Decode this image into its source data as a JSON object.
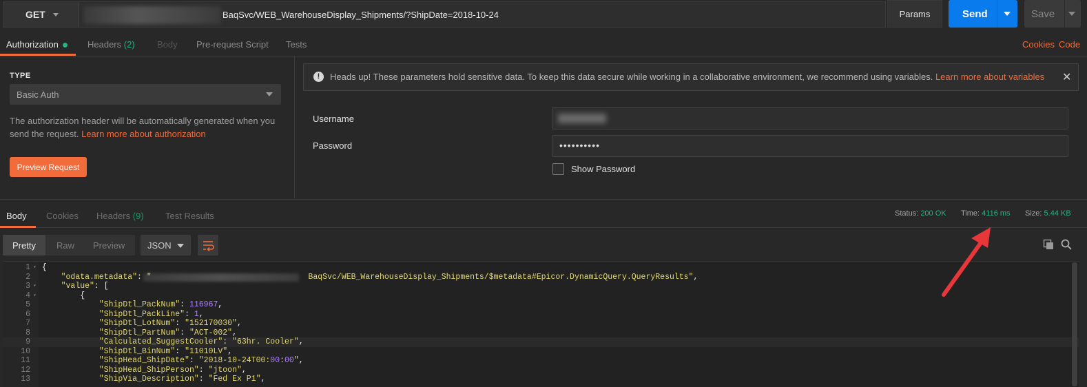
{
  "request": {
    "method": "GET",
    "url_visible": "BaqSvc/WEB_WarehouseDisplay_Shipments/?ShipDate=2018-10-24",
    "params_label": "Params",
    "send_label": "Send",
    "save_label": "Save"
  },
  "request_tabs": {
    "authorization": "Authorization",
    "headers": "Headers",
    "headers_count": "(2)",
    "body": "Body",
    "prerequest": "Pre-request Script",
    "tests": "Tests",
    "cookies": "Cookies",
    "code": "Code"
  },
  "auth": {
    "type_header": "TYPE",
    "type_value": "Basic Auth",
    "desc_line1": "The authorization header will be automatically generated when you",
    "desc_line2": "send the request.",
    "learn_link": "Learn more about authorization",
    "preview_button": "Preview Request",
    "warning_text": "Heads up! These parameters hold sensitive data. To keep this data secure while working in a collaborative environment, we recommend using variables.",
    "warning_link": "Learn more about variables",
    "username_label": "Username",
    "password_label": "Password",
    "password_value": "••••••••••",
    "show_password_label": "Show Password"
  },
  "response_tabs": {
    "body": "Body",
    "cookies": "Cookies",
    "headers": "Headers",
    "headers_count": "(9)",
    "test_results": "Test Results"
  },
  "status": {
    "status_label": "Status:",
    "status_value": "200 OK",
    "time_label": "Time:",
    "time_value": "4116 ms",
    "size_label": "Size:",
    "size_value": "5.44 KB"
  },
  "body_toolbar": {
    "pretty": "Pretty",
    "raw": "Raw",
    "preview": "Preview",
    "format": "JSON"
  },
  "code_lines": [
    {
      "n": "1",
      "fold": "▾",
      "text": "{"
    },
    {
      "n": "2",
      "fold": "",
      "text": "    \"odata.metadata\": \"                                 BaqSvc/WEB_WarehouseDisplay_Shipments/$metadata#Epicor.DynamicQuery.QueryResults\","
    },
    {
      "n": "3",
      "fold": "▾",
      "text": "    \"value\": ["
    },
    {
      "n": "4",
      "fold": "▾",
      "text": "        {"
    },
    {
      "n": "5",
      "fold": "",
      "text": "            \"ShipDtl_PackNum\": 116967,"
    },
    {
      "n": "6",
      "fold": "",
      "text": "            \"ShipDtl_PackLine\": 1,"
    },
    {
      "n": "7",
      "fold": "",
      "text": "            \"ShipDtl_LotNum\": \"152170030\","
    },
    {
      "n": "8",
      "fold": "",
      "text": "            \"ShipDtl_PartNum\": \"ACT-002\","
    },
    {
      "n": "9",
      "fold": "",
      "text": "            \"Calculated_SuggestCooler\": \"63hr. Cooler\","
    },
    {
      "n": "10",
      "fold": "",
      "text": "            \"ShipDtl_BinNum\": \"11010LV\","
    },
    {
      "n": "11",
      "fold": "",
      "text": "            \"ShipHead_ShipDate\": \"2018-10-24T00:00:00\","
    },
    {
      "n": "12",
      "fold": "",
      "text": "            \"ShipHead_ShipPerson\": \"jtoon\","
    },
    {
      "n": "13",
      "fold": "",
      "text": "            \"ShipVia_Description\": \"Fed Ex P1\","
    }
  ],
  "colors": {
    "accent": "#f26b3a",
    "send": "#097bed",
    "status_ok": "#26b47f",
    "arrow": "#e8373b"
  }
}
